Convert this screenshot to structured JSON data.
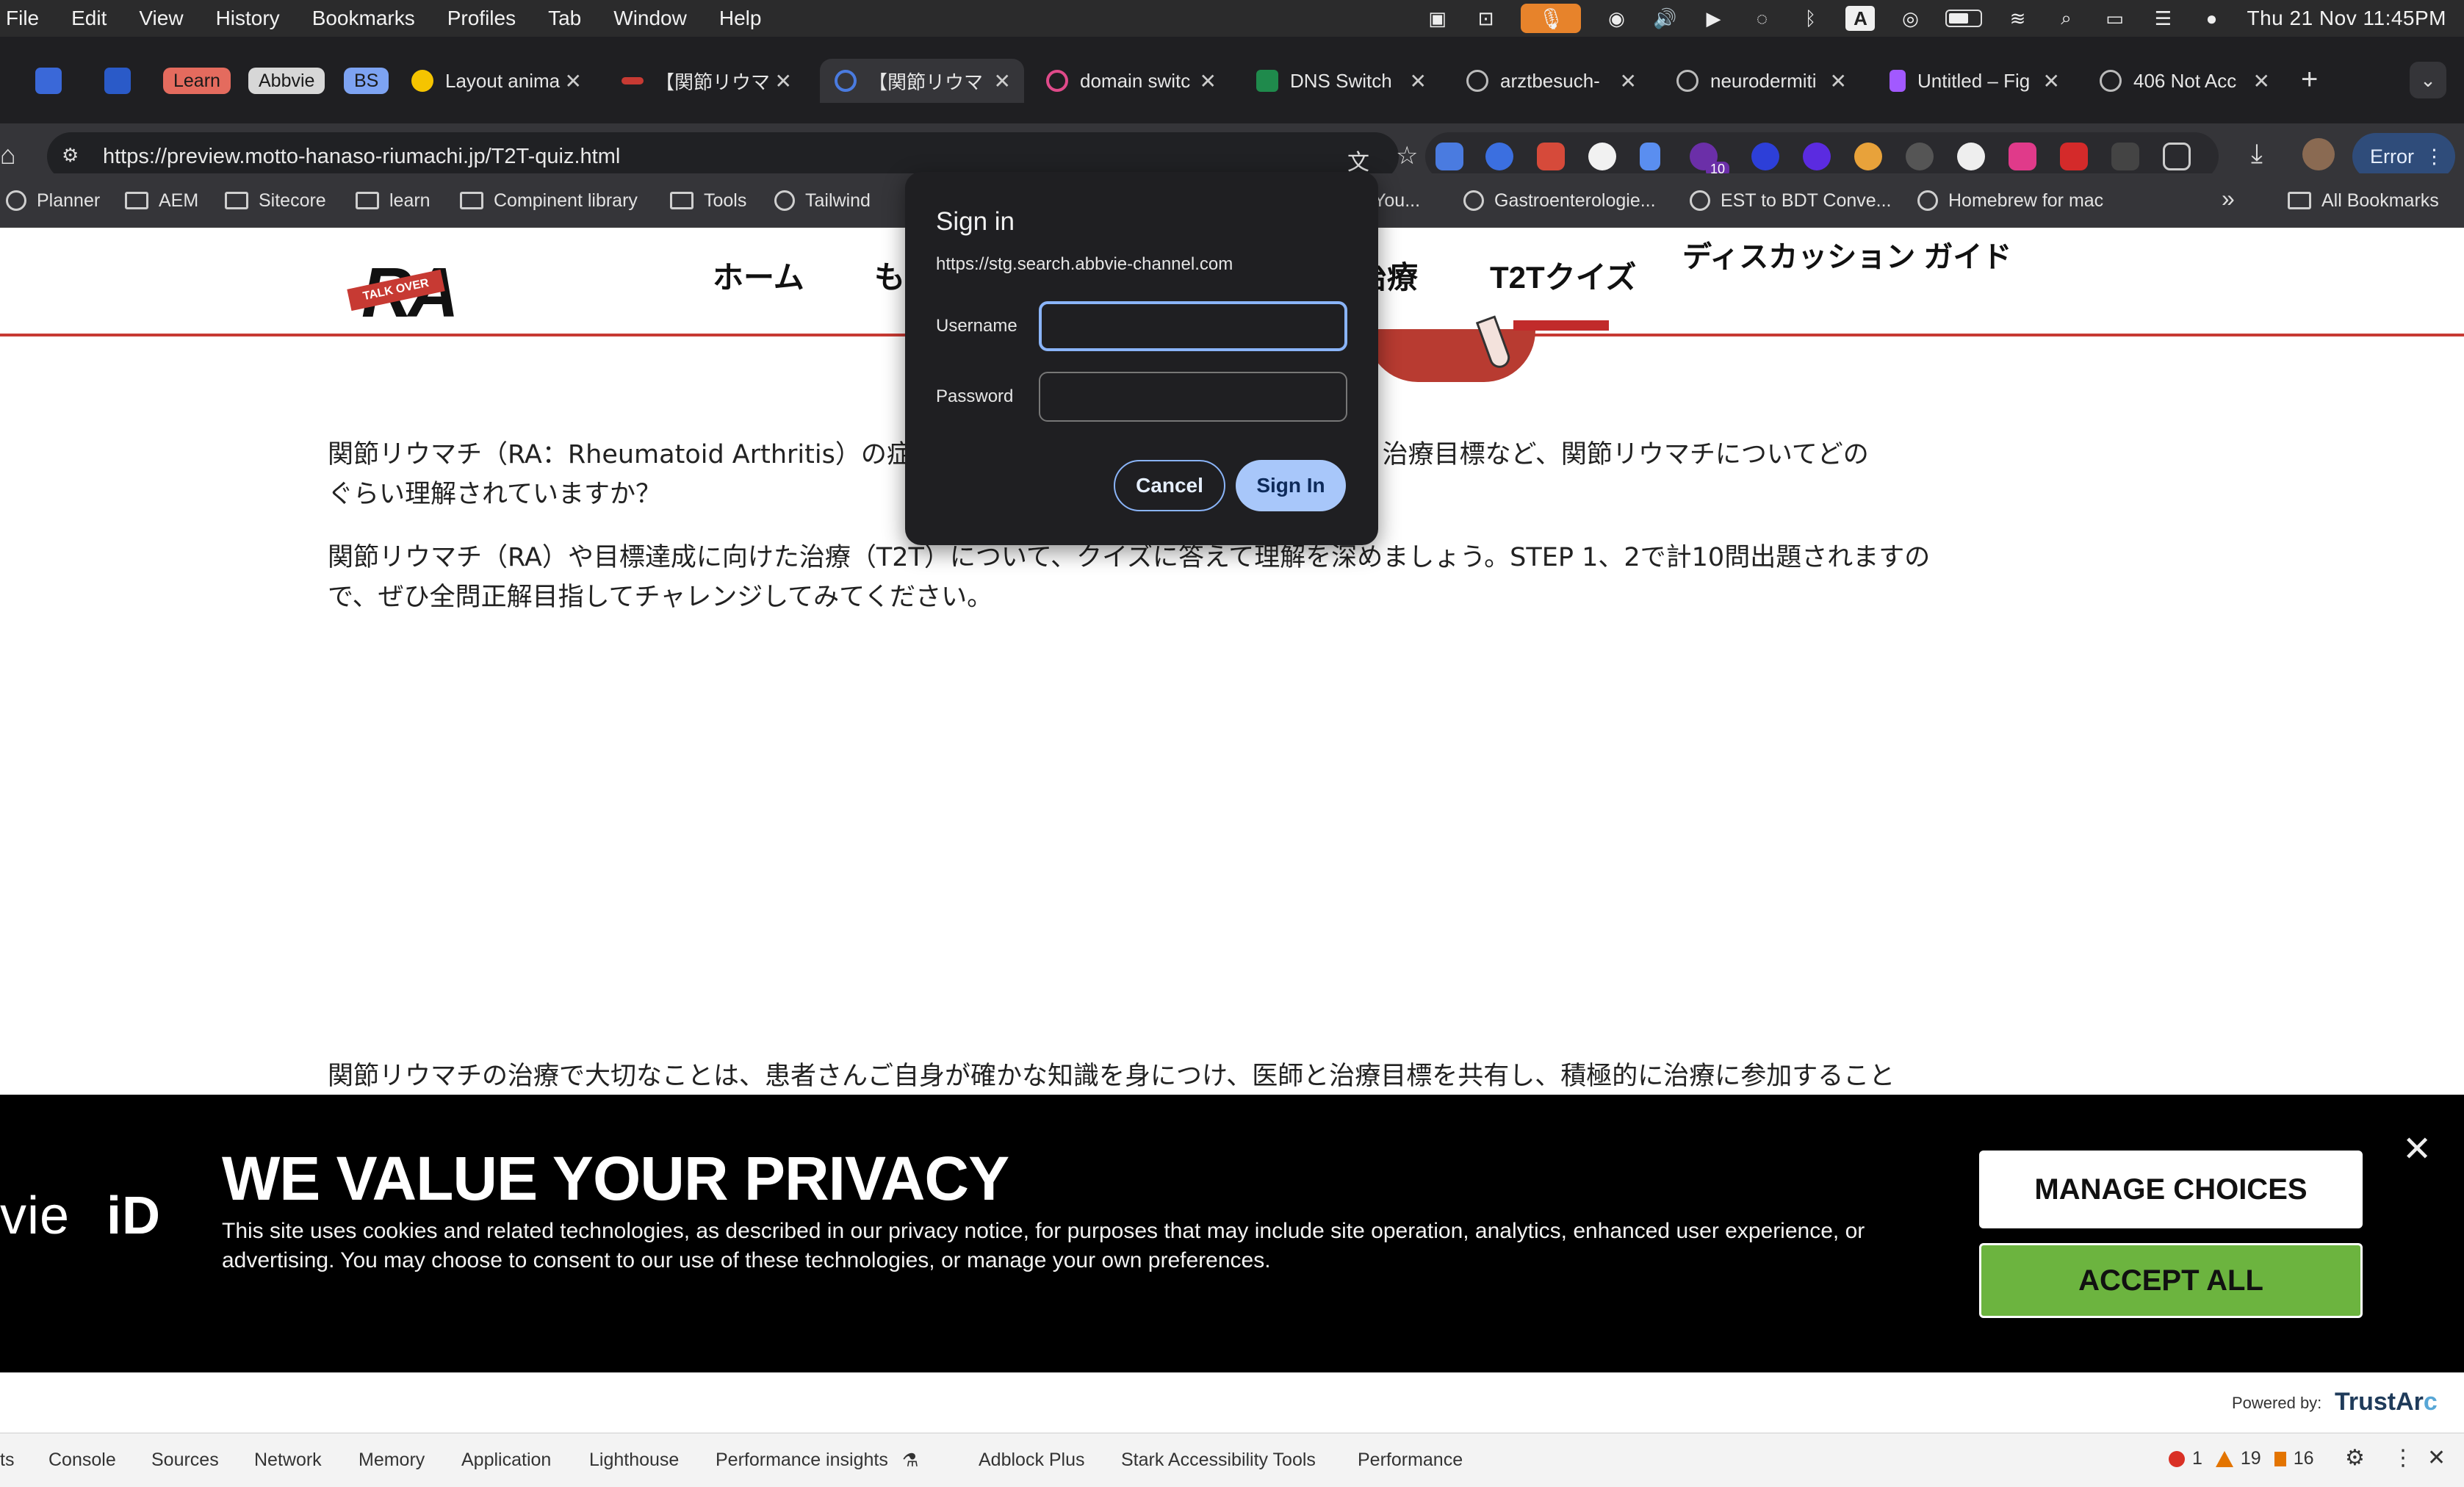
{
  "menubar": {
    "items": [
      "File",
      "Edit",
      "View",
      "History",
      "Bookmarks",
      "Profiles",
      "Tab",
      "Window",
      "Help"
    ],
    "clock": "Thu 21 Nov  11:45PM"
  },
  "tabs": {
    "pills": [
      "Learn",
      "Abbvie",
      "BS"
    ],
    "items": [
      {
        "label": "Layout anima",
        "color": "#f5c400"
      },
      {
        "label": "【関節リウマ",
        "color": "#c73a33"
      },
      {
        "label": "【関節リウマ",
        "color": "#4a7be0"
      },
      {
        "label": "domain switc",
        "color": "#e04a8a"
      },
      {
        "label": "DNS Switch",
        "color": "#1f8a4c"
      },
      {
        "label": "arztbesuch-",
        "color": "#9aa0a6"
      },
      {
        "label": "neurodermiti",
        "color": "#9aa0a6"
      },
      {
        "label": "Untitled – Fig",
        "color": "#a259ff"
      },
      {
        "label": "406 Not Acc",
        "color": "#9aa0a6"
      }
    ]
  },
  "toolbar": {
    "url": "https://preview.motto-hanaso-riumachi.jp/T2T-quiz.html",
    "error_label": "Error",
    "ext_badge": "10"
  },
  "bookmarks": {
    "left": [
      "Planner",
      "AEM",
      "Sitecore",
      "learn",
      "Compinent library",
      "Tools",
      "Tailwind"
    ],
    "right": [
      "You...",
      "Gastroenterologie...",
      "EST to BDT Conve...",
      "Homebrew for mac"
    ],
    "all": "All Bookmarks"
  },
  "site": {
    "logo_text": "RA",
    "logo_band": "TALK OVER",
    "nav": {
      "home": "ホーム",
      "mo": "も",
      "treatment": "治療",
      "quiz": "T2Tクイズ",
      "guide": "ディスカッション ガイド"
    },
    "para1_a": "関節リウマチ（RA：Rheumatoid Arthritis）の症",
    "para1_b": "と、 治療目標など、関節リウマチについてどの",
    "para1_c": "ぐらい理解されていますか？",
    "para2": "関節リウマチ（RA）や目標達成に向けた治療（T2T）について、クイズに答えて理解を深めましょう。STEP 1、2で計10問出題されますので、ぜひ全問正解目指してチャレンジしてみてください。",
    "para3": "関節リウマチの治療で大切なことは、患者さんご自身が確かな知識を身につけ、医師と治療目標を共有し、積極的に治療に参加すること"
  },
  "dialog": {
    "title": "Sign in",
    "origin": "https://stg.search.abbvie-channel.com",
    "username_label": "Username",
    "password_label": "Password",
    "username_value": "",
    "password_value": "",
    "cancel": "Cancel",
    "signin": "Sign In"
  },
  "privacy": {
    "brand_left": "vie",
    "brand_right": "iD",
    "title": "WE VALUE YOUR PRIVACY",
    "body": "This site uses cookies and related technologies, as described in our privacy notice, for purposes that may include site operation, analytics, enhanced user experience, or advertising. You may choose to consent to our use of these technologies, or manage your own preferences.",
    "manage": "MANAGE CHOICES",
    "accept": "ACCEPT ALL",
    "powered_by": "Powered by:",
    "trustarc_a": "TrustAr",
    "trustarc_b": "c"
  },
  "devtools": {
    "first": "ts",
    "tabs": [
      "Console",
      "Sources",
      "Network",
      "Memory",
      "Application",
      "Lighthouse",
      "Performance insights",
      "Adblock Plus",
      "Stark Accessibility Tools",
      "Performance"
    ],
    "errors": "1",
    "warnings": "19",
    "issues": "16"
  },
  "colors": {
    "accent_red": "#c73a33",
    "accept_green": "#6cb43f",
    "dialog_blue": "#a8c7fa"
  }
}
